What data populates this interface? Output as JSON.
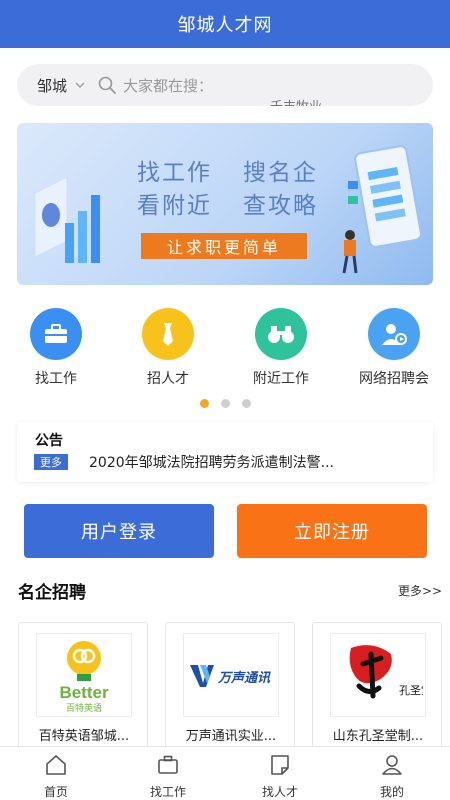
{
  "header": {
    "title": "邹城人才网"
  },
  "search": {
    "city": "邹城",
    "placeholder": "大家都在搜：",
    "scroll_hint": "千丰牧业"
  },
  "banner": {
    "line1_left": "找工作",
    "line1_right": "搜名企",
    "line2_left": "看附近",
    "line2_right": "查攻略",
    "cta": "让求职更简单"
  },
  "quick_links": [
    {
      "label": "找工作",
      "icon": "briefcase-icon",
      "color": "#3b8ff0"
    },
    {
      "label": "招人才",
      "icon": "tie-icon",
      "color": "#f7c21c"
    },
    {
      "label": "附近工作",
      "icon": "binoculars-icon",
      "color": "#2fc39c"
    },
    {
      "label": "网络招聘会",
      "icon": "video-user-icon",
      "color": "#4aa3f2"
    }
  ],
  "carousel": {
    "active_index": 0,
    "count": 3,
    "active_color": "#f5a623"
  },
  "notice": {
    "title": "公告",
    "more": "更多",
    "text": "2020年邹城法院招聘劳务派遣制法警..."
  },
  "actions": {
    "login": "用户登录",
    "register": "立即注册"
  },
  "companies_section": {
    "title": "名企招聘",
    "more": "更多>>"
  },
  "companies": [
    {
      "name": "百特英语邹城...",
      "logo_text": "Better",
      "logo_sub": "百特英语"
    },
    {
      "name": "万声通讯实业...",
      "logo_text": "万声通讯"
    },
    {
      "name": "山东孔圣堂制...",
      "logo_text": "孔圣堂"
    }
  ],
  "bottom_nav": [
    {
      "label": "首页",
      "icon": "home-icon"
    },
    {
      "label": "找工作",
      "icon": "briefcase-icon"
    },
    {
      "label": "找人才",
      "icon": "document-icon"
    },
    {
      "label": "我的",
      "icon": "user-icon"
    }
  ],
  "colors": {
    "primary": "#3c6cd7",
    "accent": "#f97316"
  }
}
